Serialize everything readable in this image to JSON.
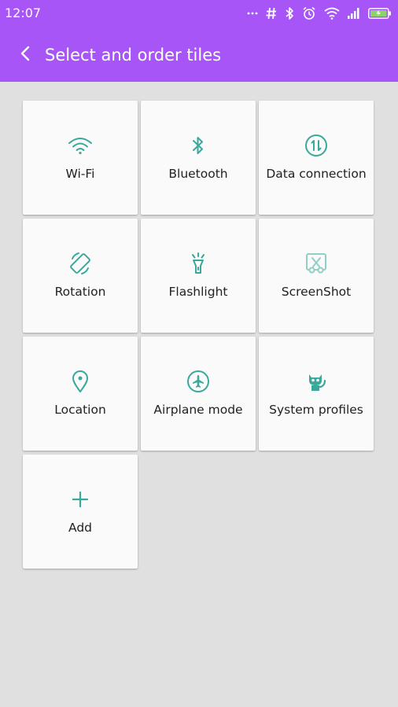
{
  "status_bar": {
    "time": "12:07",
    "icons": [
      "more-dots-icon",
      "hash-icon",
      "bluetooth-icon",
      "alarm-icon",
      "wifi-icon",
      "signal-icon",
      "battery-icon"
    ]
  },
  "header": {
    "title": "Select and order tiles",
    "back_icon": "chevron-left-icon"
  },
  "colors": {
    "appbar": "#a855f7",
    "accent": "#3aa89a",
    "background": "#e0e0e0",
    "tile": "#fafafa"
  },
  "tiles": [
    {
      "label": "Wi-Fi",
      "icon": "wifi-icon"
    },
    {
      "label": "Bluetooth",
      "icon": "bluetooth-icon"
    },
    {
      "label": "Data connection",
      "icon": "data-connection-icon"
    },
    {
      "label": "Rotation",
      "icon": "rotation-icon"
    },
    {
      "label": "Flashlight",
      "icon": "flashlight-icon"
    },
    {
      "label": "ScreenShot",
      "icon": "screenshot-icon"
    },
    {
      "label": "Location",
      "icon": "location-pin-icon"
    },
    {
      "label": "Airplane mode",
      "icon": "airplane-icon"
    },
    {
      "label": "System profiles",
      "icon": "system-profiles-icon"
    },
    {
      "label": "Add",
      "icon": "plus-icon"
    }
  ]
}
